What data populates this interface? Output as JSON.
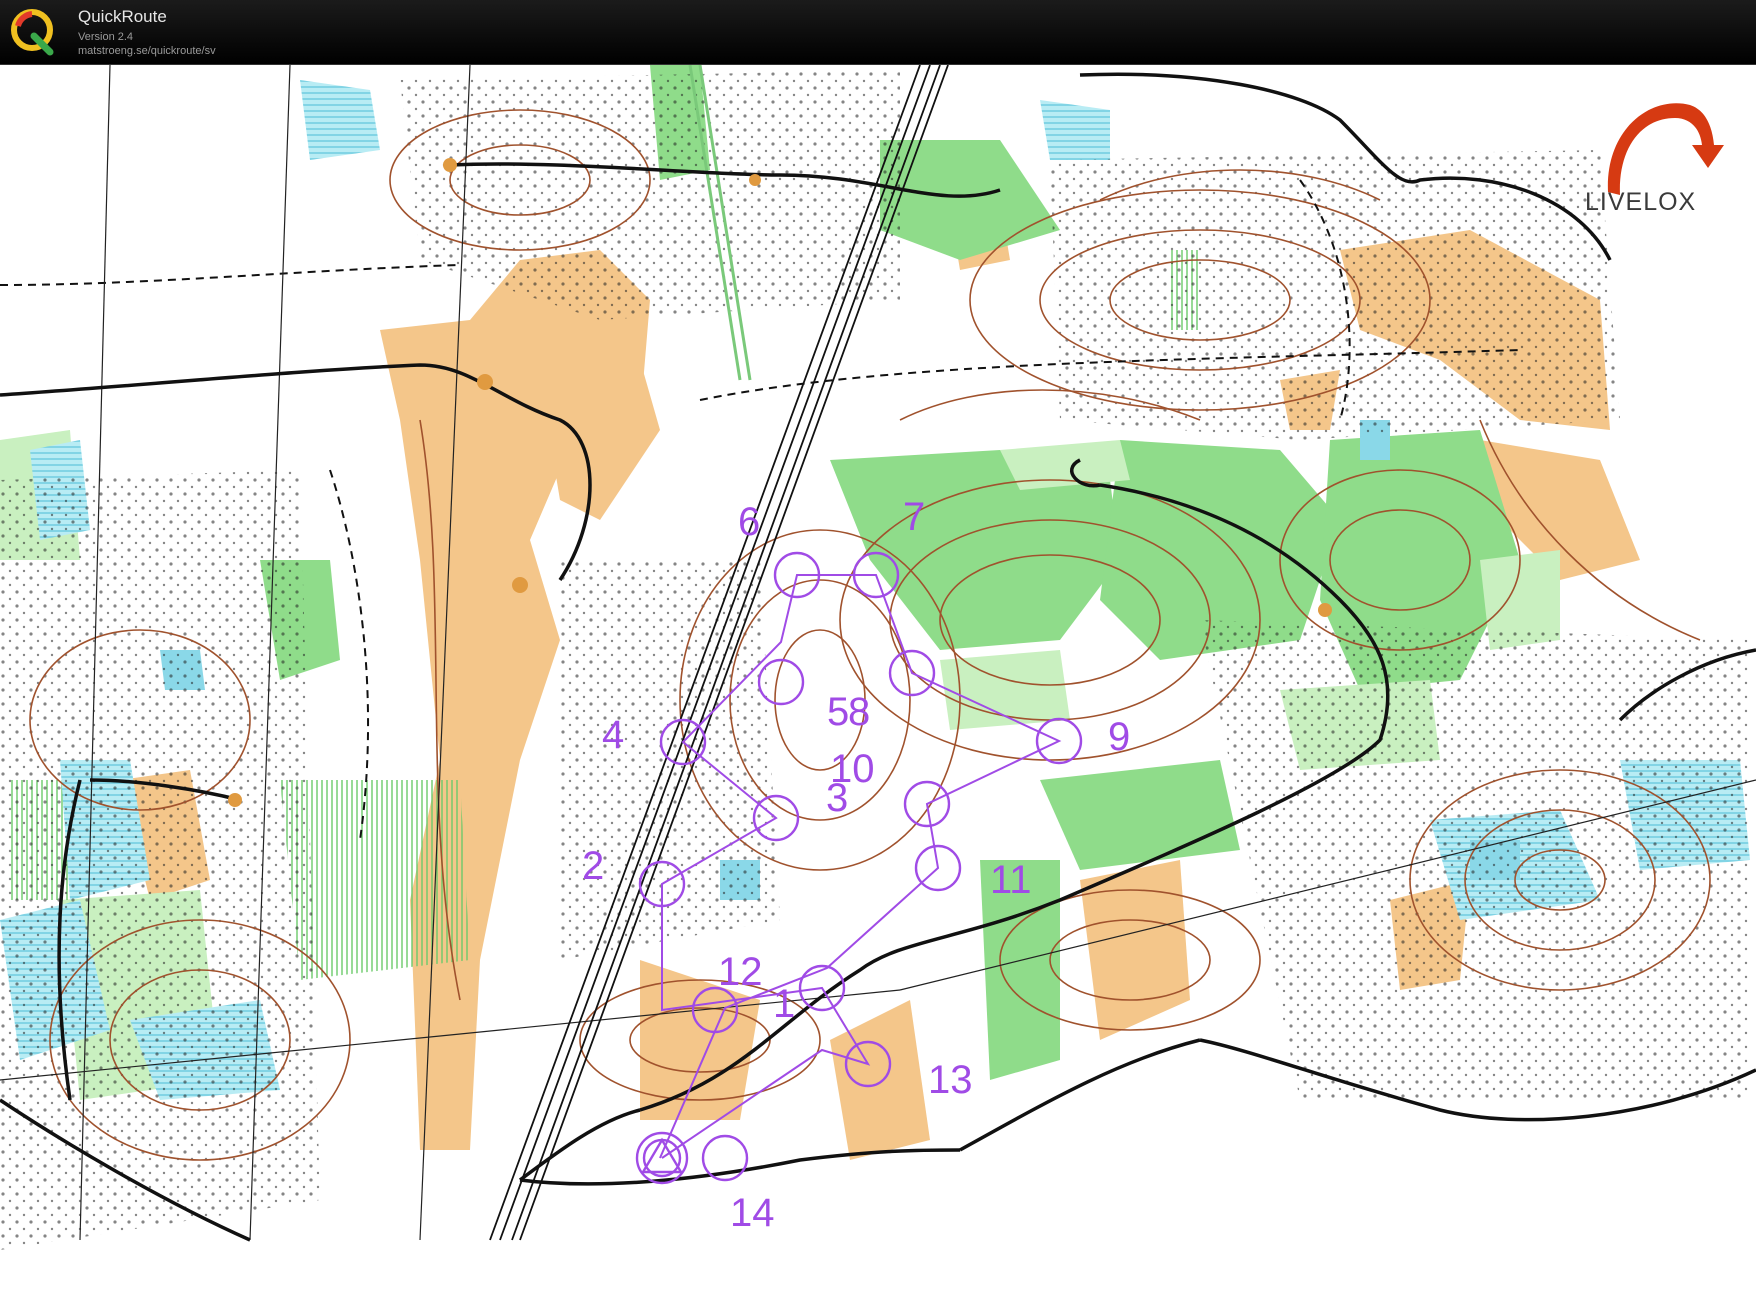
{
  "app": {
    "title": "QuickRoute",
    "version": "Version 2.4",
    "url": "matstroeng.se/quickroute/sv",
    "logo_letter": "Q"
  },
  "brand": {
    "name": "LIVELOX",
    "colors": {
      "swoosh": "#d63a12",
      "text": "#3a3a3a"
    }
  },
  "map": {
    "colors": {
      "forest": "#ffffff",
      "open_land": "#f4c68a",
      "green": "#8fdc8a",
      "light_green": "#c9f0c0",
      "water": "#8ad8e8",
      "contour": "#a0522d",
      "road": "#111111",
      "course": "#a04be6"
    },
    "course": {
      "controls": [
        {
          "label": "1",
          "kind": "control"
        },
        {
          "label": "2",
          "kind": "control"
        },
        {
          "label": "3",
          "kind": "control"
        },
        {
          "label": "4",
          "kind": "control"
        },
        {
          "label": "5",
          "kind": "control"
        },
        {
          "label": "6",
          "kind": "control"
        },
        {
          "label": "7",
          "kind": "control"
        },
        {
          "label": "8",
          "kind": "control"
        },
        {
          "label": "9",
          "kind": "control"
        },
        {
          "label": "10",
          "kind": "control"
        },
        {
          "label": "11",
          "kind": "control"
        },
        {
          "label": "12",
          "kind": "control"
        },
        {
          "label": "13",
          "kind": "control"
        },
        {
          "label": "14",
          "kind": "control"
        }
      ]
    }
  }
}
